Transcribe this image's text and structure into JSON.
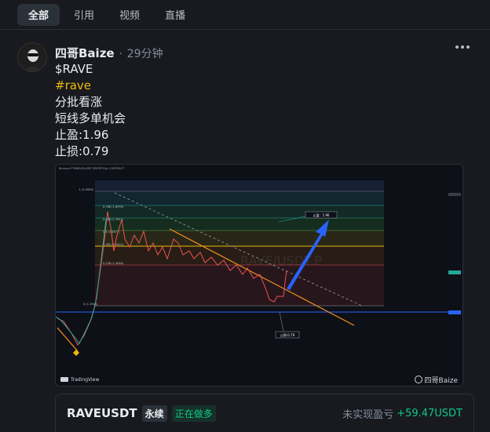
{
  "tabs": [
    {
      "label": "全部",
      "active": true
    },
    {
      "label": "引用",
      "active": false
    },
    {
      "label": "视频",
      "active": false
    },
    {
      "label": "直播",
      "active": false
    }
  ],
  "post": {
    "author": "四哥Baize",
    "separator": "·",
    "time": "29分钟",
    "lines": [
      "$RAVE",
      "#rave",
      "分批看涨",
      "短线多单机会",
      "止盈:1.96",
      "止损:0.79"
    ],
    "more_icon": "more-dots-icon"
  },
  "chart": {
    "header_text": "Binance FTNRAVE/USDT PERPETUAL CONTRACT",
    "title_text": "RAVE/USDT.P",
    "take_profit_label": "止盈：1.96",
    "stop_loss_label": "止损:0.79",
    "fib_labels": [
      "1 (2.0559)",
      "0.786 (1.8978)",
      "0.618 (1.7612)",
      "0.5 (1.6577)",
      "0.382 (1.5412)",
      "0.236 (1.4058)",
      "0 (1.1940)"
    ],
    "tradingview_label": "TradingView",
    "watermark": "四哥Baize",
    "colors": {
      "up": "#26a69a",
      "down": "#ef5350",
      "trendline": "#f7931a",
      "arrow": "#2962ff",
      "support": "#2962ff"
    }
  },
  "position": {
    "symbol": "RAVEUSDT",
    "type_badge": "永续",
    "status_badge": "正在做多",
    "pnl_label": "未实现盈亏",
    "pnl_value": "+59.47USDT"
  }
}
